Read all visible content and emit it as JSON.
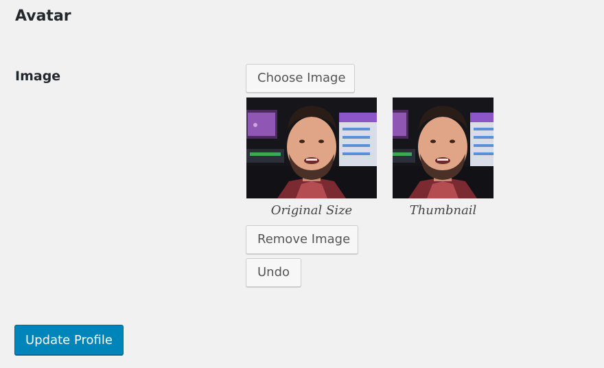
{
  "section": {
    "title": "Avatar"
  },
  "field": {
    "label": "Image"
  },
  "buttons": {
    "choose": "Choose Image",
    "remove": "Remove Image",
    "undo": "Undo"
  },
  "previews": {
    "original": {
      "caption": "Original Size"
    },
    "thumbnail": {
      "caption": "Thumbnail"
    }
  },
  "submit": {
    "label": "Update Profile"
  },
  "colors": {
    "page_background": "#f1f1f1",
    "primary_button": "#0085ba",
    "secondary_button": "#f7f7f7"
  }
}
